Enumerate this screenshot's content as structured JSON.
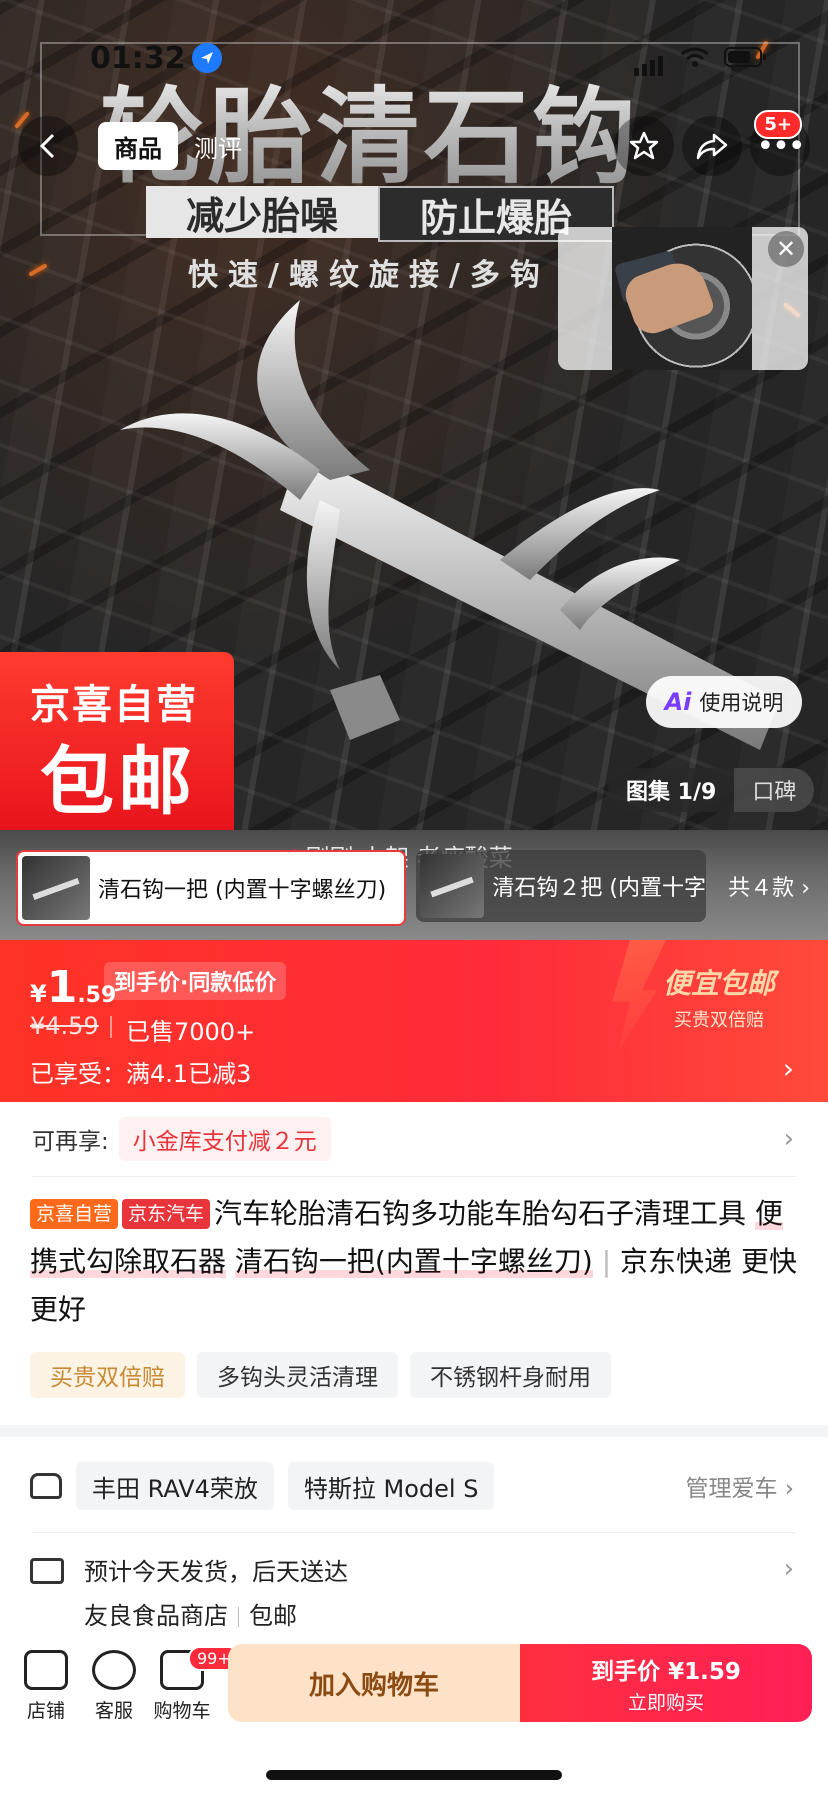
{
  "status": {
    "time": "01:32"
  },
  "nav": {
    "tab_product": "商品",
    "tab_review": "测评",
    "more_badge": "5+"
  },
  "hero": {
    "title": "轮胎清石钩",
    "pill_a": "减少胎噪",
    "pill_b": "防止爆胎",
    "subtitle": "快速/螺纹旋接/多钩",
    "badge_line1": "京喜自营",
    "badge_line2": "包邮",
    "usage_label": "使用说明",
    "gallery_label": "图集 1/9",
    "reputation_label": "口碑"
  },
  "variants": {
    "live_caption": "刚刚 上架 老痰酸菜",
    "items": [
      "清石钩一把 (内置十字螺丝刀)",
      "清石钩２把 (内置十字"
    ],
    "count_label": "共４款"
  },
  "price": {
    "symbol": "¥",
    "integer": "1",
    "decimal": ".59",
    "tag": "到手价·同款低价",
    "original": "¥4.59",
    "sold": "已售7000+",
    "promo": "已享受：满4.1已减3",
    "cheap_title": "便宜包邮",
    "cheap_sub": "买贵双倍赔"
  },
  "coupon": {
    "label": "可再享:",
    "chip": "小金库支付减２元"
  },
  "title": {
    "tag1": "京喜自营",
    "tag2": "京东汽车",
    "text1": "汽车轮胎清石钩多功能车胎勾石子清理工具",
    "text2": "便携式勾除取石器",
    "text3": "清石钩一把(内置十字螺丝刀)",
    "text4": "京东快递",
    "text5": "更快更好"
  },
  "features": [
    "买贵双倍赔",
    "多钩头灵活清理",
    "不锈钢杆身耐用"
  ],
  "cars": {
    "items": [
      "丰田 RAV4荣放",
      "特斯拉 Model S"
    ],
    "manage": "管理爱车"
  },
  "delivery": {
    "line1": "预计今天发货，后天送达",
    "shop": "友良食品商店",
    "shipping": "包邮"
  },
  "bottom": {
    "shop": "店铺",
    "service": "客服",
    "cart": "购物车",
    "cart_badge": "99+",
    "add_cart": "加入购物车",
    "buy_line1": "到手价 ¥1.59",
    "buy_line2": "立即购买"
  }
}
